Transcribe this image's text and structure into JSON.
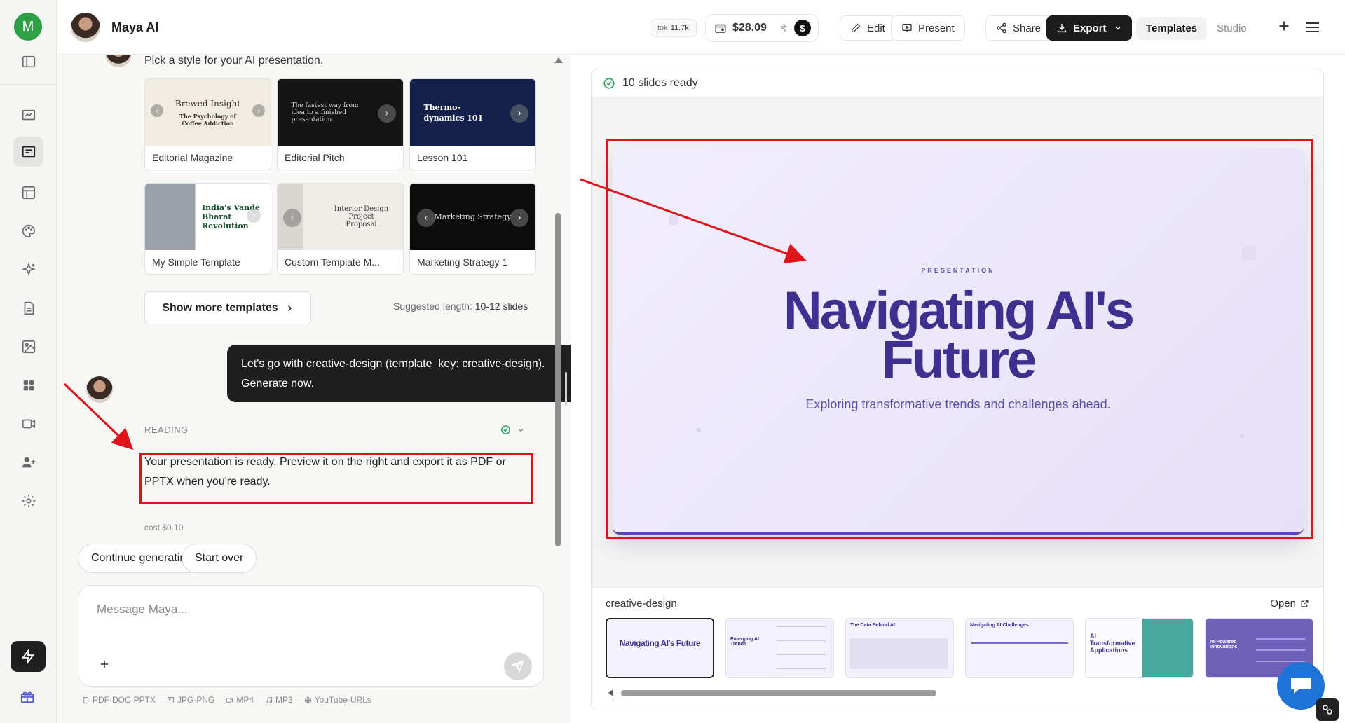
{
  "rail": {
    "user_initial": "M",
    "items": [
      "dashboard",
      "presentations",
      "layout",
      "palette",
      "sparkles",
      "document",
      "image",
      "apps",
      "video",
      "add-user",
      "settings"
    ]
  },
  "topbar": {
    "assistant_name": "Maya AI",
    "tok_label": "tok",
    "tok_value": "11.7k",
    "balance": "$28.09",
    "currency_symbol": "₹",
    "currency_badge": "$",
    "edit_label": "Edit",
    "present_label": "Present",
    "share_label": "Share",
    "export_label": "Export",
    "tabs": [
      {
        "label": "Templates",
        "active": true
      },
      {
        "label": "Studio",
        "active": false
      }
    ]
  },
  "chat": {
    "pick_style_text": "Pick a style for your AI presentation.",
    "templates": [
      {
        "name": "Editorial Magazine",
        "thumb_title": "Brewed Insight",
        "thumb_sub": "The Psychology of Coffee Addiction"
      },
      {
        "name": "Editorial Pitch",
        "thumb_title": "The fastest way from idea to a finished presentation."
      },
      {
        "name": "Lesson 101",
        "thumb_title": "Thermo-dynamics 101"
      },
      {
        "name": "My Simple Template",
        "thumb_title": "India's Vande Bharat Revolution"
      },
      {
        "name": "Custom Template M...",
        "thumb_title": "Interior Design Project Proposal"
      },
      {
        "name": "Marketing Strategy 1",
        "thumb_title": "Marketing Strategy"
      }
    ],
    "show_more_label": "Show more templates",
    "suggested_prefix": "Suggested length:",
    "suggested_value": "10-12 slides",
    "user_message": "Let's go with creative-design (template_key: creative-design). Generate now.",
    "reading_label": "READING",
    "assistant_message": "Your presentation is ready. Preview it on the right and export it as PDF or PPTX when you're ready.",
    "cost": "cost $0.10",
    "suggestions": [
      "Continue generating",
      "Start over"
    ],
    "composer_placeholder": "Message Maya...",
    "formats": [
      "PDF·DOC·PPTX",
      "JPG·PNG",
      "MP4",
      "MP3",
      "YouTube·URLs"
    ]
  },
  "preview": {
    "status": "10 slides ready",
    "slide": {
      "eyebrow": "PRESENTATION",
      "title_line1": "Navigating AI's",
      "title_line2": "Future",
      "subtitle": "Exploring transformative trends and challenges ahead."
    },
    "template_name": "creative-design",
    "open_label": "Open",
    "thumbnails": [
      {
        "title": "Navigating AI's Future"
      },
      {
        "title": "Emerging AI Trends"
      },
      {
        "title": "The Data Behind AI"
      },
      {
        "title": "Navigating AI Challenges"
      },
      {
        "title": "AI Transformative Applications"
      },
      {
        "title": "AI-Powered Innovations"
      }
    ]
  },
  "colors": {
    "accent_purple": "#3f2f8f",
    "annotation_red": "#e0131a",
    "success_green": "#2aa35a",
    "chat_fab_blue": "#1f73d6"
  }
}
